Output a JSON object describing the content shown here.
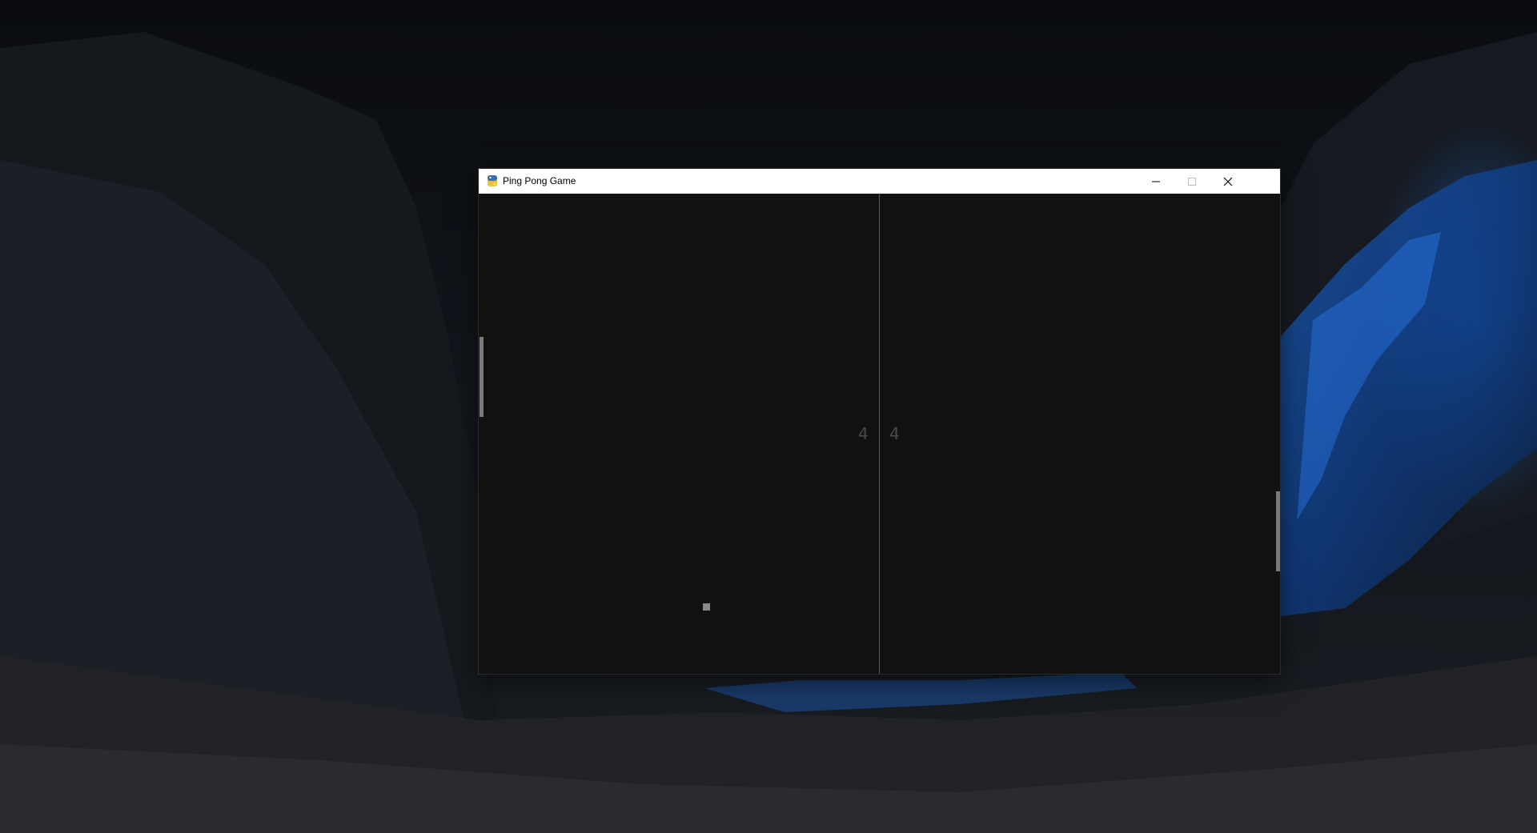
{
  "window": {
    "title": "Ping Pong Game",
    "app_icon": "python-icon",
    "buttons": {
      "minimize_icon": "minimize-icon",
      "maximize_icon": "maximize-icon",
      "close_icon": "close-icon"
    }
  },
  "game": {
    "score_left": "4",
    "score_right": "4",
    "colors": {
      "background": "#111111",
      "paddle": "#7a7a7a",
      "ball": "#8a8a8a",
      "score": "#4a4a4a",
      "center_line": "#5a5a5a"
    }
  },
  "desktop": {
    "wallpaper": "dark mountain valley with blue illuminated rock"
  }
}
